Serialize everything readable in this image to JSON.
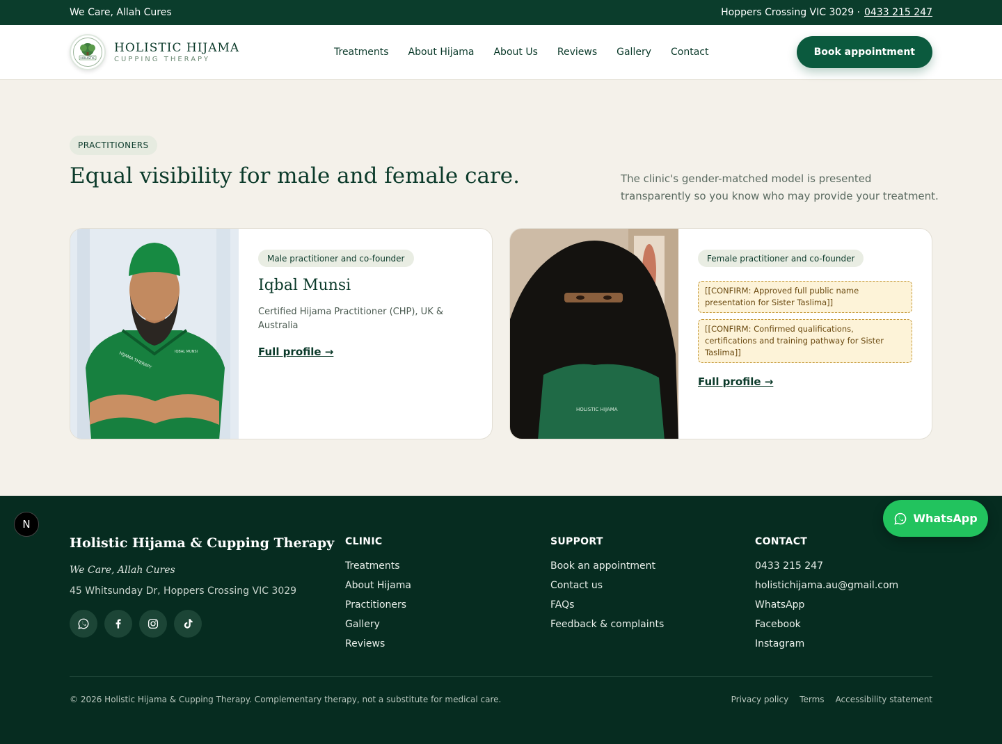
{
  "topbar": {
    "tagline": "We Care, Allah Cures",
    "location": "Hoppers Crossing VIC 3029 ·",
    "phone": "0433 215 247"
  },
  "header": {
    "logo_line1": "HOLISTIC HIJAMA",
    "logo_line2": "CUPPING THERAPY",
    "logo_badge_text": "HOLISTIC",
    "nav": [
      "Treatments",
      "About Hijama",
      "About Us",
      "Reviews",
      "Gallery",
      "Contact"
    ],
    "book_label": "Book appointment"
  },
  "section": {
    "pill": "PRACTITIONERS",
    "heading": "Equal visibility for male and female care.",
    "intro": "The clinic's gender-matched model is presented transparently so you know who may provide your treatment."
  },
  "cards": [
    {
      "role": "Male practitioner and co-founder",
      "name": "Iqbal Munsi",
      "desc": "Certified Hijama Practitioner (CHP), UK & Australia",
      "link": "Full profile →",
      "shirt_text_left": "HIJAMA THERAPY",
      "shirt_text_right": "IQBAL MUNSI"
    },
    {
      "role": "Female practitioner and co-founder",
      "confirm1": "[[CONFIRM: Approved full public name presentation for Sister Taslima]]",
      "confirm2": "[[CONFIRM: Confirmed qualifications, certifications and training pathway for Sister Taslima]]",
      "link": "Full profile →",
      "shirt_text": "HOLISTIC HIJAMA"
    }
  ],
  "footer": {
    "brand": "Holistic Hijama & Cupping Therapy",
    "tagline": "We Care, Allah Cures",
    "address": "45 Whitsunday Dr, Hoppers Crossing VIC 3029",
    "clinic": {
      "title": "CLINIC",
      "items": [
        "Treatments",
        "About Hijama",
        "Practitioners",
        "Gallery",
        "Reviews"
      ]
    },
    "support": {
      "title": "SUPPORT",
      "items": [
        "Book an appointment",
        "Contact us",
        "FAQs",
        "Feedback & complaints"
      ]
    },
    "contact": {
      "title": "CONTACT",
      "items": [
        "0433 215 247",
        "holistichijama.au@gmail.com",
        "WhatsApp",
        "Facebook",
        "Instagram"
      ]
    },
    "copyright": "© 2026 Holistic Hijama & Cupping Therapy. Complementary therapy, not a substitute for medical care.",
    "legal": [
      "Privacy policy",
      "Terms",
      "Accessibility statement"
    ]
  },
  "whatsapp_fab": "WhatsApp",
  "dev_badge": "N",
  "colors": {
    "brand_dark": "#0b3d2c",
    "brand_button": "#0b5a3e",
    "footer_bg": "#062c20",
    "whatsapp": "#22c35e",
    "confirm_bg": "#fdf3d8"
  }
}
